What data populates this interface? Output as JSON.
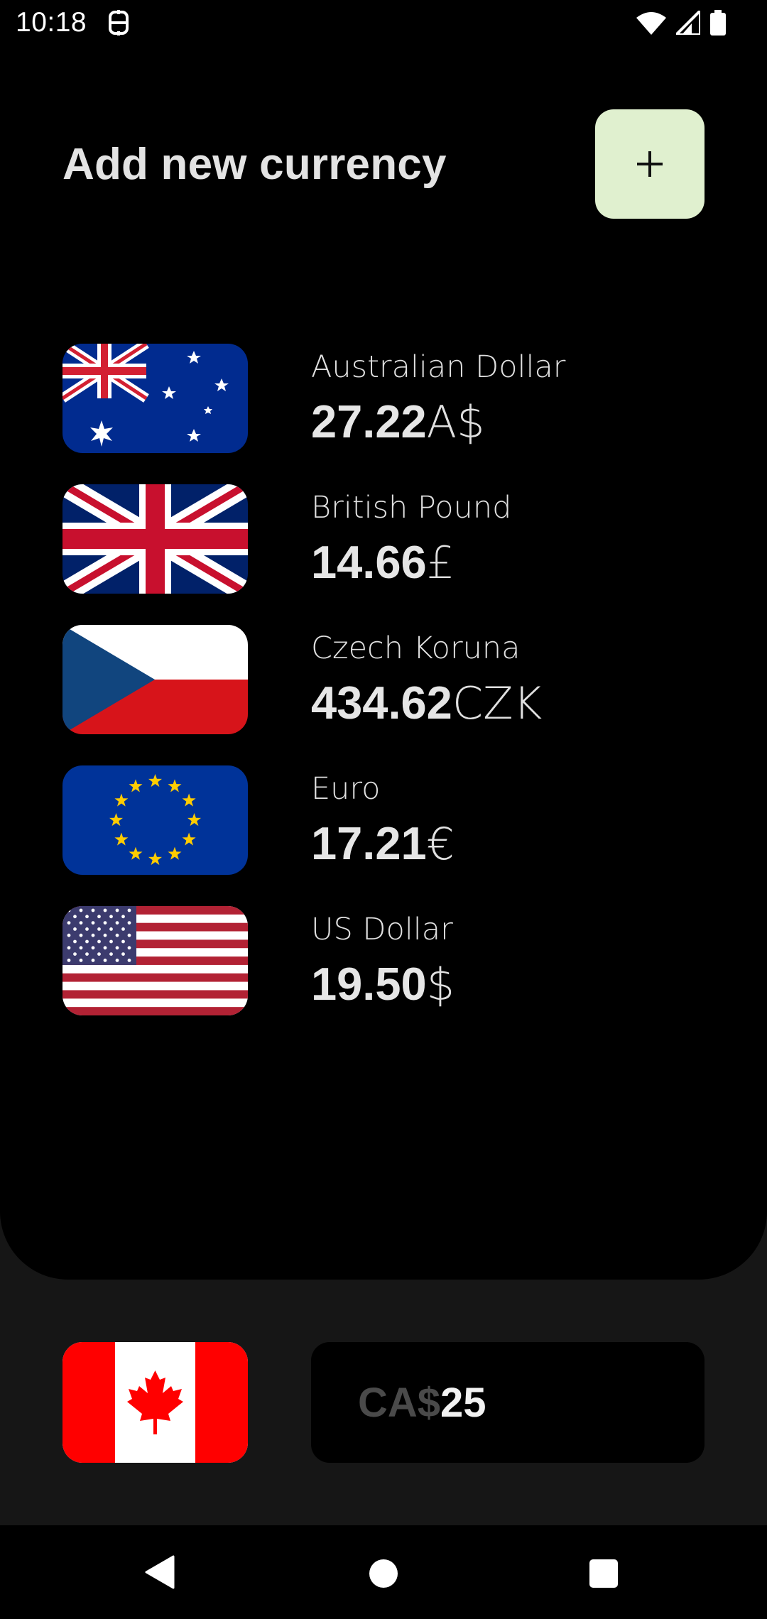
{
  "status_bar": {
    "time": "10:18",
    "icons": [
      "app-notification-icon",
      "wifi-icon",
      "signal-icon",
      "battery-icon"
    ]
  },
  "header": {
    "title": "Add new currency",
    "add_button_icon": "plus-icon"
  },
  "currencies": [
    {
      "name": "Australian Dollar",
      "value": "27.22",
      "symbol": "A$",
      "flag": "australia-flag"
    },
    {
      "name": "British Pound",
      "value": "14.66",
      "symbol": "£",
      "flag": "uk-flag"
    },
    {
      "name": "Czech Koruna",
      "value": "434.62",
      "symbol": "CZK",
      "flag": "czech-flag"
    },
    {
      "name": "Euro",
      "value": "17.21",
      "symbol": "€",
      "flag": "eu-flag"
    },
    {
      "name": "US Dollar",
      "value": "19.50",
      "symbol": "$",
      "flag": "usa-flag"
    }
  ],
  "base": {
    "flag": "canada-flag",
    "prefix": "CA$",
    "amount": "25"
  },
  "nav_bar": {
    "icons": [
      "back-icon",
      "home-icon",
      "recents-icon"
    ]
  },
  "colors": {
    "background": "#000000",
    "bottom_area": "#161616",
    "add_button": "#e0f0cf",
    "prefix_text": "#4a4a4a"
  }
}
